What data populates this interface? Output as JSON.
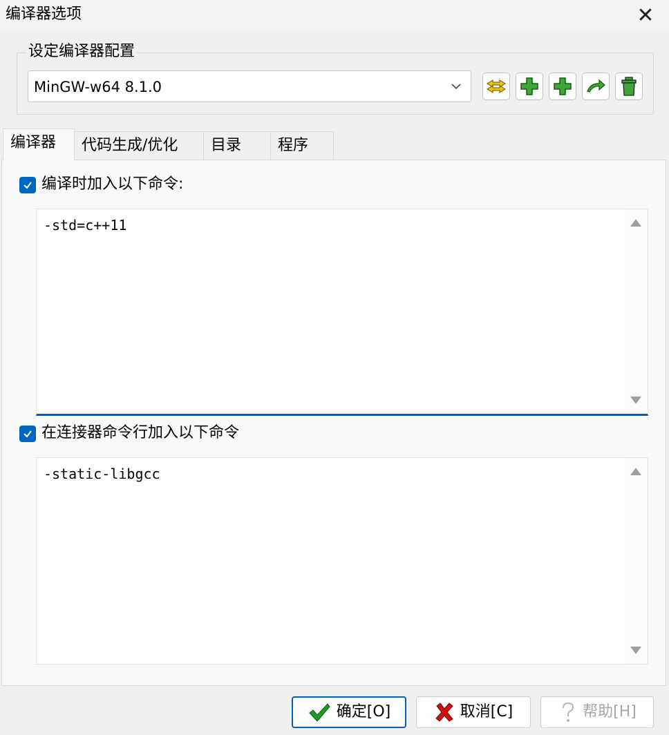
{
  "window": {
    "title": "编译器选项",
    "close_glyph": "✕"
  },
  "config_group": {
    "label": "设定编译器配置",
    "selected_config": "MinGW-w64 8.1.0",
    "toolbar_icons": [
      "rename-config-icon",
      "add-config-icon",
      "copy-config-icon",
      "reset-config-icon",
      "delete-config-icon"
    ]
  },
  "tabs": [
    {
      "label": "编译器",
      "active": true
    },
    {
      "label": "代码生成/优化",
      "active": false
    },
    {
      "label": "目录",
      "active": false
    },
    {
      "label": "程序",
      "active": false
    }
  ],
  "compiler_tab": {
    "compile_checkbox_label": "编译时加入以下命令:",
    "compile_checked": true,
    "compile_commands": "-std=c++11",
    "linker_checkbox_label": "在连接器命令行加入以下命令",
    "linker_checked": true,
    "linker_commands": "-static-libgcc"
  },
  "buttons": {
    "ok_label": "确定[O]",
    "cancel_label": "取消[C]",
    "help_label": "帮助[H]",
    "help_enabled": false
  },
  "colors": {
    "accent": "#0067c0",
    "focus_underline": "#005fb8",
    "ok_check": "#1e9a2a",
    "cancel_x": "#d01010",
    "icon_green": "#3fa535",
    "icon_yellow": "#e8c414"
  }
}
